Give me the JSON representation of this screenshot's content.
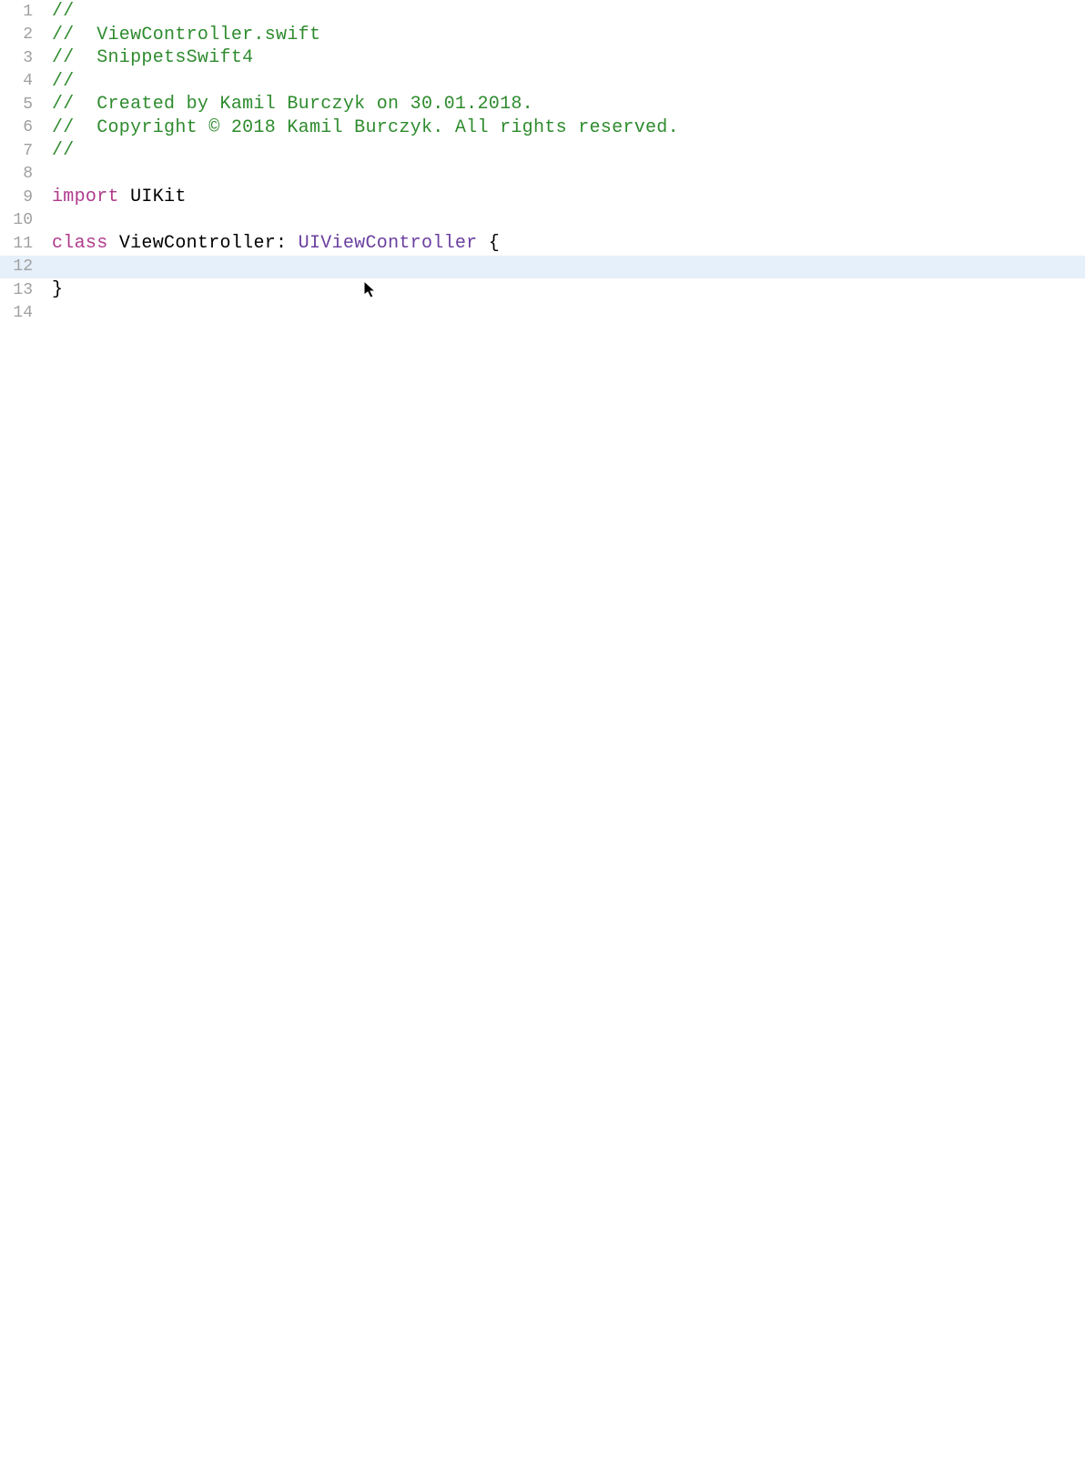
{
  "lines": [
    {
      "num": "1",
      "highlighted": false,
      "tokens": [
        {
          "cls": "comment",
          "text": "//"
        }
      ]
    },
    {
      "num": "2",
      "highlighted": false,
      "tokens": [
        {
          "cls": "comment",
          "text": "//  ViewController.swift"
        }
      ]
    },
    {
      "num": "3",
      "highlighted": false,
      "tokens": [
        {
          "cls": "comment",
          "text": "//  SnippetsSwift4"
        }
      ]
    },
    {
      "num": "4",
      "highlighted": false,
      "tokens": [
        {
          "cls": "comment",
          "text": "//"
        }
      ]
    },
    {
      "num": "5",
      "highlighted": false,
      "tokens": [
        {
          "cls": "comment",
          "text": "//  Created by Kamil Burczyk on 30.01.2018."
        }
      ]
    },
    {
      "num": "6",
      "highlighted": false,
      "tokens": [
        {
          "cls": "comment",
          "text": "//  Copyright © 2018 Kamil Burczyk. All rights reserved."
        }
      ]
    },
    {
      "num": "7",
      "highlighted": false,
      "tokens": [
        {
          "cls": "comment",
          "text": "//"
        }
      ]
    },
    {
      "num": "8",
      "highlighted": false,
      "tokens": []
    },
    {
      "num": "9",
      "highlighted": false,
      "tokens": [
        {
          "cls": "keyword",
          "text": "import"
        },
        {
          "cls": "plain",
          "text": " UIKit"
        }
      ]
    },
    {
      "num": "10",
      "highlighted": false,
      "tokens": []
    },
    {
      "num": "11",
      "highlighted": false,
      "tokens": [
        {
          "cls": "keyword",
          "text": "class"
        },
        {
          "cls": "plain",
          "text": " ViewController: "
        },
        {
          "cls": "type",
          "text": "UIViewController"
        },
        {
          "cls": "plain",
          "text": " {"
        }
      ]
    },
    {
      "num": "12",
      "highlighted": true,
      "tokens": []
    },
    {
      "num": "13",
      "highlighted": false,
      "tokens": [
        {
          "cls": "plain",
          "text": "}"
        }
      ]
    },
    {
      "num": "14",
      "highlighted": false,
      "tokens": []
    }
  ]
}
